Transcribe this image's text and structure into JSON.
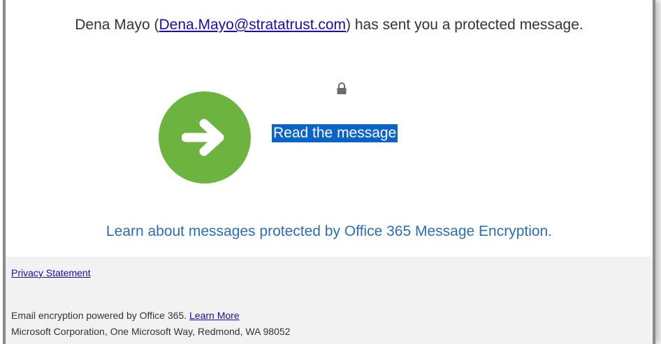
{
  "header": {
    "sender_name": "Dena Mayo",
    "open_paren": "(",
    "sender_email": "Dena.Mayo@stratatrust.com",
    "message_suffix": ") has sent you a protected message."
  },
  "main": {
    "lock_icon": "lock-icon",
    "arrow_icon": "arrow-right-icon",
    "read_link": "Read the message",
    "learn_link": "Learn about messages protected by Office 365 Message Encryption."
  },
  "footer": {
    "privacy_link": "Privacy Statement",
    "powered_text": "Email encryption powered by Office 365.",
    "learn_more_link": "Learn More",
    "address": "Microsoft Corporation, One Microsoft Way, Redmond, WA 98052"
  },
  "colors": {
    "arrow_circle": "#6db33f",
    "read_highlight": "#0a64c8",
    "learn_link": "#2a6fb0",
    "footer_bg": "#f2f2f2"
  }
}
